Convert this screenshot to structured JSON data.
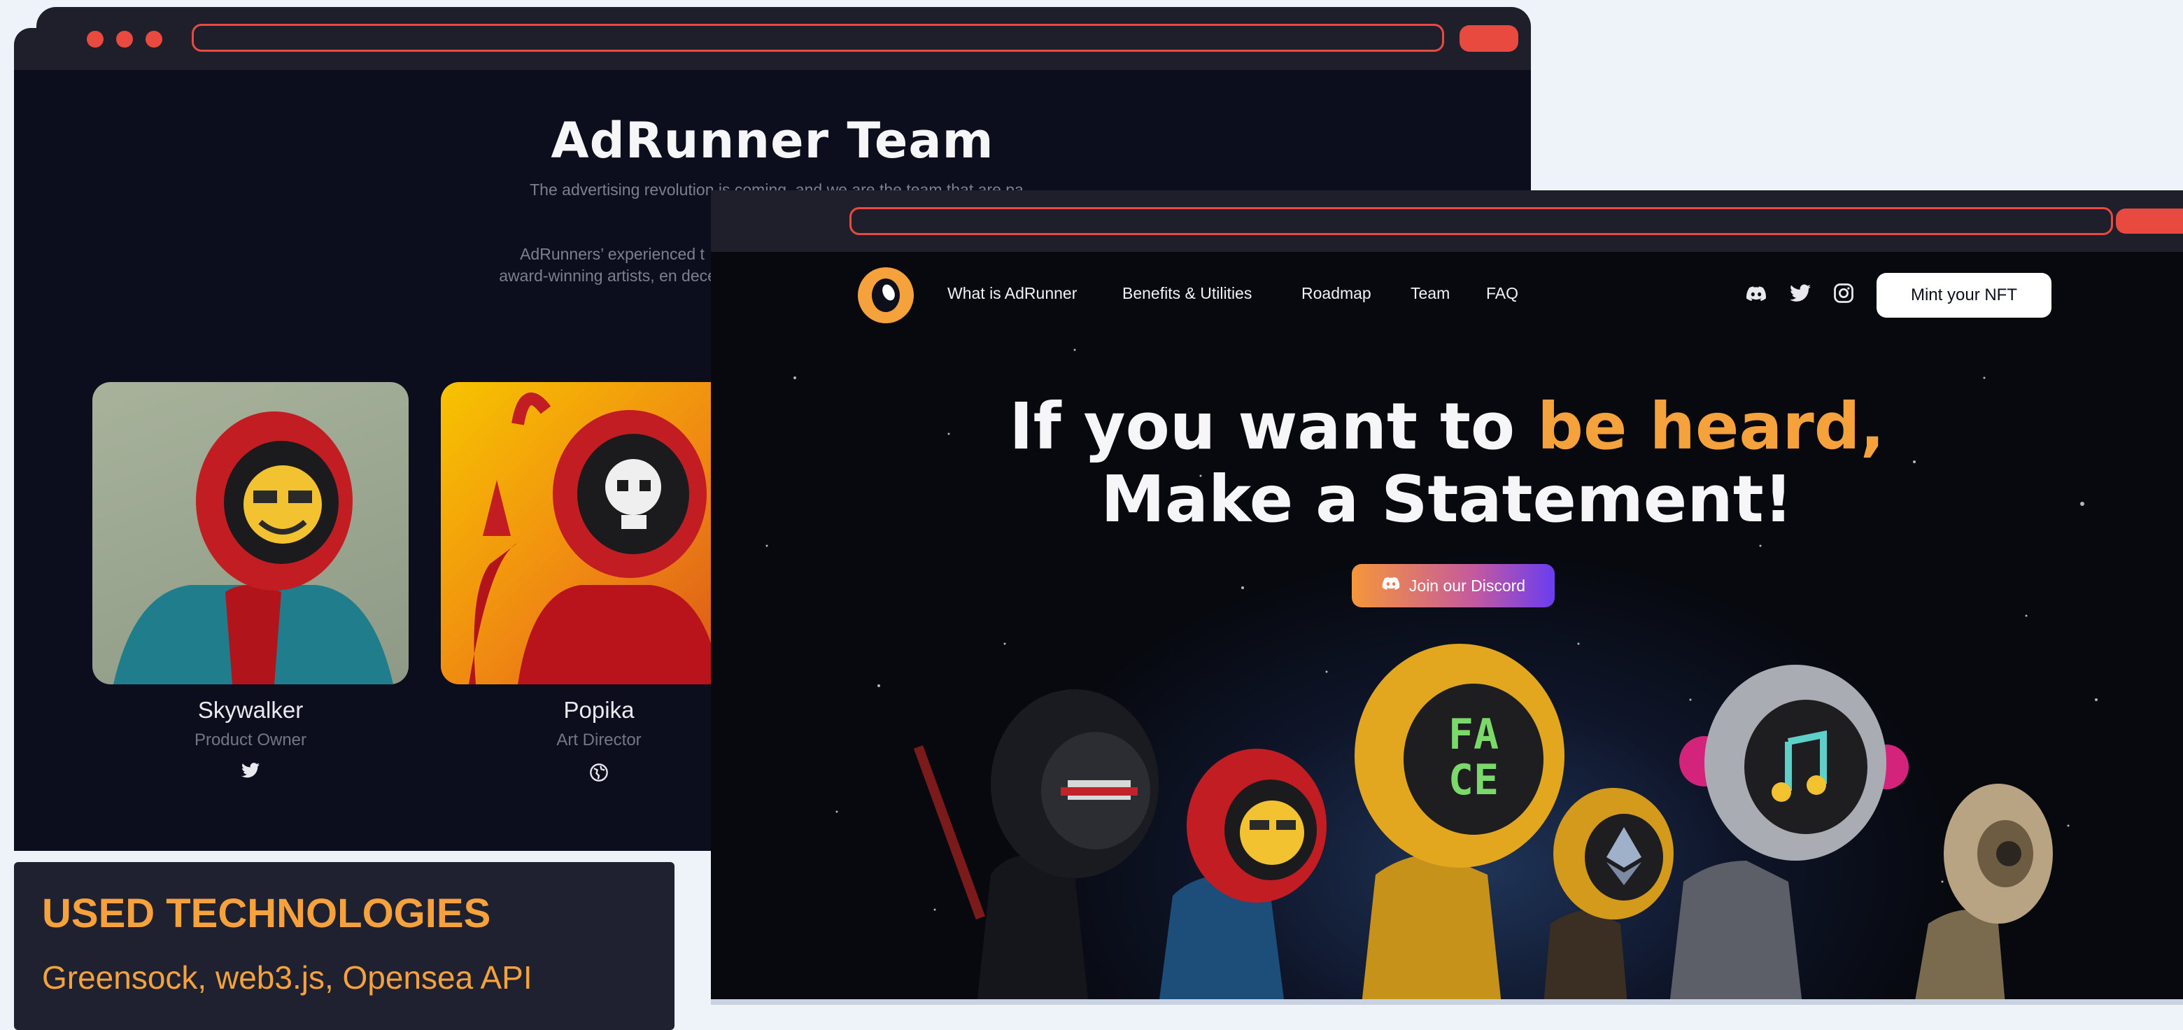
{
  "back_window": {
    "title": "AdRunner Team",
    "intro": "The advertising revolution is coming, and we are the team that are pa",
    "body": "AdRunners’ experienced t award-winning artists, en decen",
    "members": [
      {
        "name": "Skywalker",
        "role": "Product Owner",
        "social": "twitter-icon"
      },
      {
        "name": "Popika",
        "role": "Art Director",
        "social": "globe-icon"
      }
    ]
  },
  "tech_panel": {
    "title": "USED TECHNOLOGIES",
    "list": "Greensock, web3.js, Opensea API"
  },
  "front_window": {
    "nav": {
      "items": [
        "What is AdRunner",
        "Benefits & Utilities",
        "Roadmap",
        "Team",
        "FAQ"
      ],
      "social_icons": [
        "discord-icon",
        "twitter-icon",
        "instagram-icon"
      ],
      "cta": "Mint your NFT"
    },
    "hero": {
      "line1_plain": "If you want to ",
      "line1_accent": "be heard,",
      "line2": "Make a Statement!"
    },
    "discord_button": "Join our Discord"
  },
  "colors": {
    "accent": "#f5a23d",
    "browser_red": "#e84a3f",
    "dark_bg": "#0c0e1d",
    "panel_bg": "#1f2130"
  }
}
